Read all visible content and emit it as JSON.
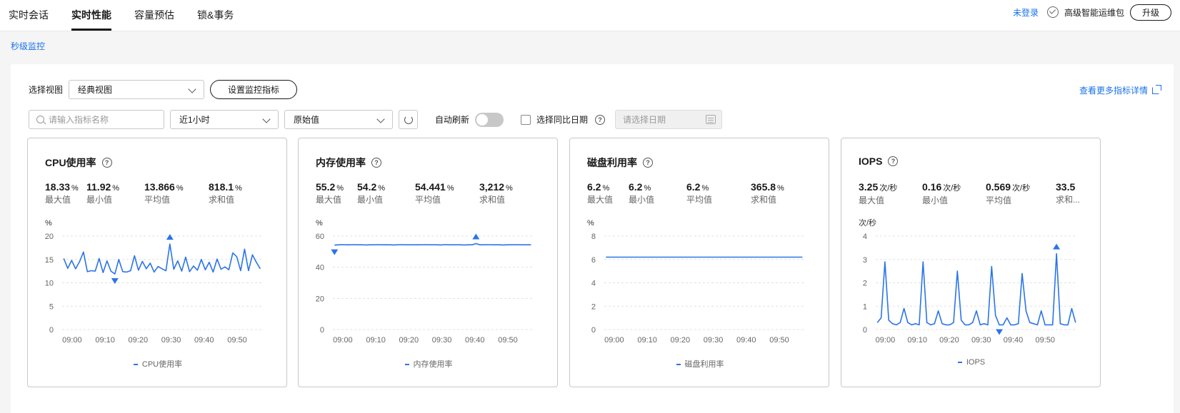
{
  "tabs": [
    {
      "label": "实时会话"
    },
    {
      "label": "实时性能"
    },
    {
      "label": "容量预估"
    },
    {
      "label": "锁&事务"
    }
  ],
  "header": {
    "login_link": "未登录",
    "package_label": "高级智能运维包",
    "upgrade_label": "升级"
  },
  "sub_link": "秒级监控",
  "toolbar": {
    "view_label": "选择视图",
    "view_value": "经典视图",
    "set_metrics_label": "设置监控指标",
    "more_link": "查看更多指标详情",
    "search_placeholder": "请输入指标名称",
    "time_range": "近1小时",
    "value_type": "原始值",
    "auto_refresh_label": "自动刷新",
    "compare_label": "选择同比日期",
    "date_placeholder": "请选择日期"
  },
  "stat_labels": [
    "最大值",
    "最小值",
    "平均值",
    "求和值"
  ],
  "cards": [
    {
      "title": "CPU使用率",
      "stats": [
        {
          "value": "18.33",
          "unit": "%"
        },
        {
          "value": "11.92",
          "unit": "%"
        },
        {
          "value": "13.866",
          "unit": "%"
        },
        {
          "value": "818.1",
          "unit": "%"
        }
      ],
      "y_unit": "%",
      "legend": "CPU使用率"
    },
    {
      "title": "内存使用率",
      "stats": [
        {
          "value": "55.2",
          "unit": "%"
        },
        {
          "value": "54.2",
          "unit": "%"
        },
        {
          "value": "54.441",
          "unit": "%"
        },
        {
          "value": "3,212",
          "unit": "%"
        }
      ],
      "y_unit": "%",
      "legend": "内存使用率"
    },
    {
      "title": "磁盘利用率",
      "stats": [
        {
          "value": "6.2",
          "unit": "%"
        },
        {
          "value": "6.2",
          "unit": "%"
        },
        {
          "value": "6.2",
          "unit": "%"
        },
        {
          "value": "365.8",
          "unit": "%"
        }
      ],
      "y_unit": "%",
      "legend": "磁盘利用率"
    },
    {
      "title": "IOPS",
      "stats": [
        {
          "value": "3.25",
          "unit": "次/秒"
        },
        {
          "value": "0.16",
          "unit": "次/秒"
        },
        {
          "value": "0.569",
          "unit": "次/秒"
        },
        {
          "value": "33.5",
          "unit": ""
        }
      ],
      "y_unit": "次/秒",
      "legend": "IOPS",
      "truncated_label": "求和..."
    }
  ],
  "colors": {
    "series": "#2b74e8",
    "accent_link": "#1a73e8",
    "grid": "#e0e0e0"
  },
  "chart_data": [
    {
      "type": "line",
      "title": "CPU使用率",
      "ylabel": "%",
      "ylim": [
        0,
        20
      ],
      "yticks": [
        0,
        5,
        10,
        15,
        20
      ],
      "xticks": [
        "09:00",
        "09:10",
        "09:20",
        "09:30",
        "09:40",
        "09:50"
      ],
      "x_start_minute": -3,
      "x_end_minute": 58,
      "series": [
        {
          "name": "CPU使用率",
          "values": [
            15.2,
            13.1,
            14.8,
            13.0,
            14.5,
            16.6,
            12.4,
            12.6,
            12.5,
            15.2,
            12.2,
            14.7,
            12.5,
            11.9,
            15.0,
            12.4,
            12.3,
            12.6,
            15.8,
            12.7,
            14.6,
            13.0,
            14.2,
            12.3,
            13.5,
            13.0,
            12.6,
            18.3,
            12.9,
            14.7,
            12.5,
            15.5,
            12.4,
            13.6,
            12.7,
            15.0,
            12.8,
            14.4,
            12.3,
            15.1,
            12.9,
            13.4,
            12.8,
            16.4,
            15.6,
            12.6,
            17.2,
            12.6,
            16.0,
            14.4,
            13.0
          ]
        }
      ],
      "max_marker_index": 27,
      "min_marker_index": 13
    },
    {
      "type": "line",
      "title": "内存使用率",
      "ylabel": "%",
      "ylim": [
        0,
        60
      ],
      "yticks": [
        0,
        20,
        40,
        60
      ],
      "xticks": [
        "09:00",
        "09:10",
        "09:20",
        "09:30",
        "09:40",
        "09:50"
      ],
      "x_start_minute": -3,
      "x_end_minute": 58,
      "series": [
        {
          "name": "内存使用率",
          "values": [
            54.2,
            54.4,
            54.5,
            54.4,
            54.4,
            54.5,
            54.4,
            54.4,
            54.3,
            54.4,
            54.4,
            54.5,
            54.4,
            54.4,
            54.4,
            54.3,
            54.4,
            54.5,
            54.4,
            54.4,
            54.4,
            54.4,
            54.4,
            54.5,
            54.4,
            54.4,
            54.4,
            54.3,
            54.5,
            54.4,
            54.4,
            54.4,
            54.4,
            54.3,
            54.4,
            54.4,
            55.2,
            54.4,
            54.4,
            54.5,
            54.4,
            54.4,
            54.4,
            54.3,
            54.4,
            54.4,
            54.5,
            54.4,
            54.4,
            54.4,
            54.4
          ]
        }
      ],
      "max_marker_index": 36,
      "min_marker_index": 0
    },
    {
      "type": "line",
      "title": "磁盘利用率",
      "ylabel": "%",
      "ylim": [
        0,
        8
      ],
      "yticks": [
        0,
        2,
        4,
        6,
        8
      ],
      "xticks": [
        "09:00",
        "09:10",
        "09:20",
        "09:30",
        "09:40",
        "09:50"
      ],
      "x_start_minute": -3,
      "x_end_minute": 58,
      "series": [
        {
          "name": "磁盘利用率",
          "values": [
            6.2,
            6.2,
            6.2,
            6.2,
            6.2,
            6.2,
            6.2,
            6.2,
            6.2,
            6.2,
            6.2,
            6.2,
            6.2,
            6.2,
            6.2,
            6.2,
            6.2,
            6.2,
            6.2,
            6.2,
            6.2,
            6.2,
            6.2,
            6.2,
            6.2,
            6.2,
            6.2,
            6.2,
            6.2,
            6.2,
            6.2,
            6.2,
            6.2,
            6.2,
            6.2,
            6.2,
            6.2,
            6.2,
            6.2,
            6.2,
            6.2,
            6.2,
            6.2,
            6.2,
            6.2,
            6.2,
            6.2,
            6.2,
            6.2,
            6.2,
            6.2
          ]
        }
      ]
    },
    {
      "type": "line",
      "title": "IOPS",
      "ylabel": "次/秒",
      "ylim": [
        0,
        4
      ],
      "yticks": [
        0,
        1,
        2,
        3,
        4
      ],
      "xticks": [
        "09:00",
        "09:10",
        "09:20",
        "09:30",
        "09:40",
        "09:50"
      ],
      "x_start_minute": -3,
      "x_end_minute": 58,
      "series": [
        {
          "name": "IOPS",
          "values": [
            0.3,
            0.5,
            2.9,
            0.4,
            0.25,
            0.2,
            0.3,
            0.9,
            0.3,
            0.2,
            0.25,
            0.2,
            2.9,
            0.3,
            0.2,
            0.25,
            0.8,
            0.25,
            0.2,
            0.2,
            0.3,
            2.5,
            0.4,
            0.2,
            0.2,
            0.3,
            0.8,
            0.2,
            0.25,
            0.2,
            2.7,
            0.6,
            0.2,
            0.2,
            0.5,
            0.2,
            0.2,
            0.25,
            2.4,
            0.8,
            0.3,
            0.25,
            0.2,
            0.8,
            0.2,
            0.2,
            0.2,
            3.25,
            0.25,
            0.2,
            0.2,
            0.9,
            0.3
          ]
        }
      ],
      "x_end_minute_override": 60,
      "max_marker_index": 47,
      "min_marker_index": 32
    }
  ]
}
